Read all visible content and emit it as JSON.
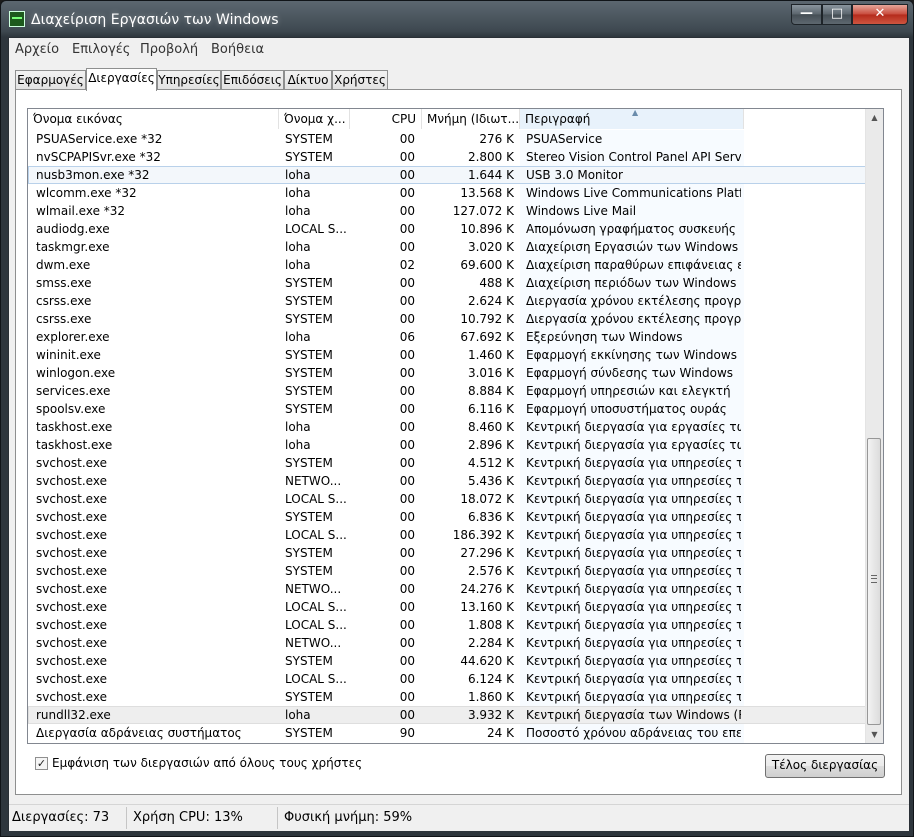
{
  "window": {
    "title": "Διαχείριση Εργασιών των Windows"
  },
  "menu": [
    "Αρχείο",
    "Επιλογές",
    "Προβολή",
    "Βοήθεια"
  ],
  "tabs": [
    "Εφαρμογές",
    "Διεργασίες",
    "Υπηρεσίες",
    "Επιδόσεις",
    "Δίκτυο",
    "Χρήστες"
  ],
  "active_tab": "Διεργασίες",
  "columns": {
    "name": "Όνομα εικόνας",
    "user": "Όνομα χ...",
    "cpu": "CPU",
    "mem": "Μνήμη (Ιδιωτ...",
    "desc": "Περιγραφή"
  },
  "rows": [
    {
      "name": "PSUAService.exe *32",
      "user": "SYSTEM",
      "cpu": "00",
      "mem": "276 K",
      "desc": "PSUAService"
    },
    {
      "name": "nvSCPAPISvr.exe *32",
      "user": "SYSTEM",
      "cpu": "00",
      "mem": "2.800 K",
      "desc": "Stereo Vision Control Panel API Server"
    },
    {
      "name": "nusb3mon.exe *32",
      "user": "loha",
      "cpu": "00",
      "mem": "1.644 K",
      "desc": "USB 3.0 Monitor"
    },
    {
      "name": "wlcomm.exe *32",
      "user": "loha",
      "cpu": "00",
      "mem": "13.568 K",
      "desc": "Windows Live Communications Platf..."
    },
    {
      "name": "wlmail.exe *32",
      "user": "loha",
      "cpu": "00",
      "mem": "127.072 K",
      "desc": "Windows Live Mail"
    },
    {
      "name": "audiodg.exe",
      "user": "LOCAL S...",
      "cpu": "00",
      "mem": "10.896 K",
      "desc": "Απομόνωση γραφήματος συσκευής ..."
    },
    {
      "name": "taskmgr.exe",
      "user": "loha",
      "cpu": "00",
      "mem": "3.020 K",
      "desc": "Διαχείριση Εργασιών των Windows"
    },
    {
      "name": "dwm.exe",
      "user": "loha",
      "cpu": "02",
      "mem": "69.600 K",
      "desc": "Διαχείριση παραθύρων επιφάνειας ερ..."
    },
    {
      "name": "smss.exe",
      "user": "SYSTEM",
      "cpu": "00",
      "mem": "488 K",
      "desc": "Διαχείριση περιόδων των Windows"
    },
    {
      "name": "csrss.exe",
      "user": "SYSTEM",
      "cpu": "00",
      "mem": "2.624 K",
      "desc": "Διεργασία χρόνου εκτέλεσης προγρά..."
    },
    {
      "name": "csrss.exe",
      "user": "SYSTEM",
      "cpu": "00",
      "mem": "10.792 K",
      "desc": "Διεργασία χρόνου εκτέλεσης προγρά..."
    },
    {
      "name": "explorer.exe",
      "user": "loha",
      "cpu": "06",
      "mem": "67.692 K",
      "desc": "Εξερεύνηση των Windows"
    },
    {
      "name": "wininit.exe",
      "user": "SYSTEM",
      "cpu": "00",
      "mem": "1.460 K",
      "desc": "Εφαρμογή εκκίνησης των Windows"
    },
    {
      "name": "winlogon.exe",
      "user": "SYSTEM",
      "cpu": "00",
      "mem": "3.016 K",
      "desc": "Εφαρμογή σύνδεσης των Windows"
    },
    {
      "name": "services.exe",
      "user": "SYSTEM",
      "cpu": "00",
      "mem": "8.884 K",
      "desc": "Εφαρμογή υπηρεσιών και ελεγκτή"
    },
    {
      "name": "spoolsv.exe",
      "user": "SYSTEM",
      "cpu": "00",
      "mem": "6.116 K",
      "desc": "Εφαρμογή υποσυστήματος ουράς"
    },
    {
      "name": "taskhost.exe",
      "user": "loha",
      "cpu": "00",
      "mem": "8.460 K",
      "desc": "Κεντρική διεργασία για εργασίες των ..."
    },
    {
      "name": "taskhost.exe",
      "user": "loha",
      "cpu": "00",
      "mem": "2.896 K",
      "desc": "Κεντρική διεργασία για εργασίες των ..."
    },
    {
      "name": "svchost.exe",
      "user": "SYSTEM",
      "cpu": "00",
      "mem": "4.512 K",
      "desc": "Κεντρική διεργασία για υπηρεσίες των..."
    },
    {
      "name": "svchost.exe",
      "user": "NETWO...",
      "cpu": "00",
      "mem": "5.436 K",
      "desc": "Κεντρική διεργασία για υπηρεσίες των..."
    },
    {
      "name": "svchost.exe",
      "user": "LOCAL S...",
      "cpu": "00",
      "mem": "18.072 K",
      "desc": "Κεντρική διεργασία για υπηρεσίες των..."
    },
    {
      "name": "svchost.exe",
      "user": "SYSTEM",
      "cpu": "00",
      "mem": "6.836 K",
      "desc": "Κεντρική διεργασία για υπηρεσίες των..."
    },
    {
      "name": "svchost.exe",
      "user": "LOCAL S...",
      "cpu": "00",
      "mem": "186.392 K",
      "desc": "Κεντρική διεργασία για υπηρεσίες των..."
    },
    {
      "name": "svchost.exe",
      "user": "SYSTEM",
      "cpu": "00",
      "mem": "27.296 K",
      "desc": "Κεντρική διεργασία για υπηρεσίες των..."
    },
    {
      "name": "svchost.exe",
      "user": "SYSTEM",
      "cpu": "00",
      "mem": "2.576 K",
      "desc": "Κεντρική διεργασία για υπηρεσίες των..."
    },
    {
      "name": "svchost.exe",
      "user": "NETWO...",
      "cpu": "00",
      "mem": "24.276 K",
      "desc": "Κεντρική διεργασία για υπηρεσίες των..."
    },
    {
      "name": "svchost.exe",
      "user": "LOCAL S...",
      "cpu": "00",
      "mem": "13.160 K",
      "desc": "Κεντρική διεργασία για υπηρεσίες των..."
    },
    {
      "name": "svchost.exe",
      "user": "LOCAL S...",
      "cpu": "00",
      "mem": "1.808 K",
      "desc": "Κεντρική διεργασία για υπηρεσίες των..."
    },
    {
      "name": "svchost.exe",
      "user": "NETWO...",
      "cpu": "00",
      "mem": "2.284 K",
      "desc": "Κεντρική διεργασία για υπηρεσίες των..."
    },
    {
      "name": "svchost.exe",
      "user": "SYSTEM",
      "cpu": "00",
      "mem": "44.620 K",
      "desc": "Κεντρική διεργασία για υπηρεσίες των..."
    },
    {
      "name": "svchost.exe",
      "user": "LOCAL S...",
      "cpu": "00",
      "mem": "6.124 K",
      "desc": "Κεντρική διεργασία για υπηρεσίες των..."
    },
    {
      "name": "svchost.exe",
      "user": "SYSTEM",
      "cpu": "00",
      "mem": "1.860 K",
      "desc": "Κεντρική διεργασία για υπηρεσίες των..."
    },
    {
      "name": "rundll32.exe",
      "user": "loha",
      "cpu": "00",
      "mem": "3.932 K",
      "desc": "Κεντρική διεργασία των Windows (R..."
    },
    {
      "name": "Διεργασία αδράνειας συστήματος",
      "user": "SYSTEM",
      "cpu": "90",
      "mem": "24 K",
      "desc": "Ποσοστό χρόνου αδράνειας του επε..."
    }
  ],
  "selected_row_index": 2,
  "hover_row_index": 32,
  "show_all_users": {
    "label": "Εμφάνιση των διεργασιών από όλους τους χρήστες",
    "checked": true
  },
  "end_process_button": "Τέλος διεργασίας",
  "status": {
    "processes": "Διεργασίες: 73",
    "cpu": "Χρήση CPU: 13%",
    "memory": "Φυσική μνήμη: 59%"
  },
  "icons": {
    "app": "task-manager-icon",
    "minimize": "minimize-icon",
    "maximize": "maximize-icon",
    "close": "close-icon",
    "sort": "sort-ascending-icon"
  }
}
